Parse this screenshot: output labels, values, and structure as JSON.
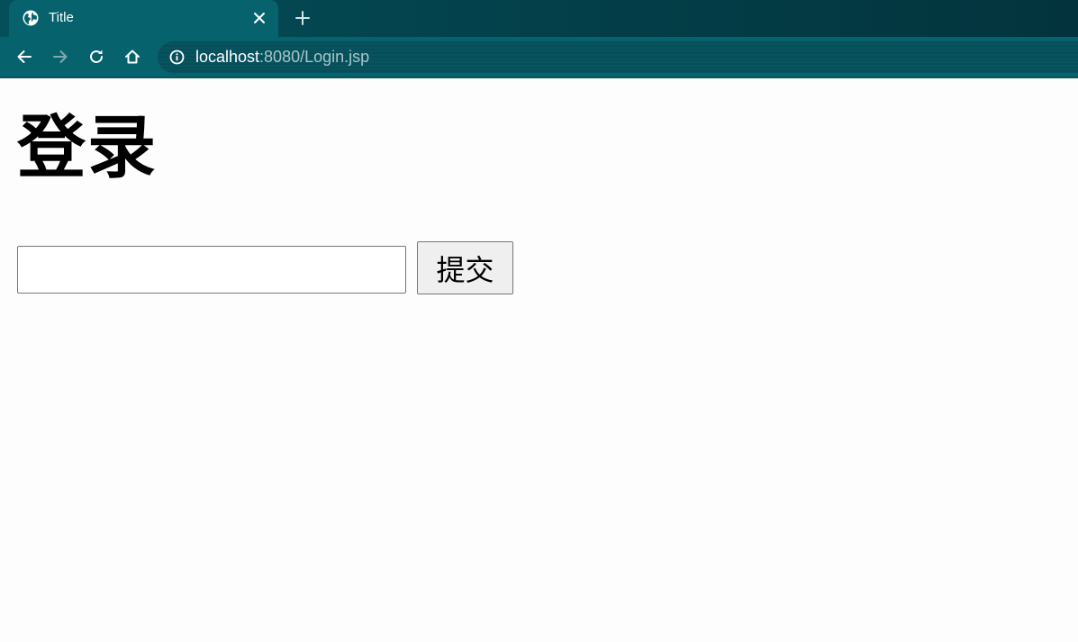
{
  "tab": {
    "title": "Title",
    "favicon": "globe-icon"
  },
  "toolbar": {
    "icons": [
      "back-arrow-icon",
      "forward-arrow-icon",
      "reload-icon",
      "home-icon",
      "info-icon"
    ],
    "url_host": "localhost",
    "url_rest": ":8080/Login.jsp"
  },
  "page": {
    "title": "登录",
    "input_value": "",
    "input_placeholder": "",
    "submit_label": "提交"
  },
  "colors": {
    "tab_bg": "#06626d",
    "toolbar_bg": "#06626d",
    "tabstrip_bg": "#03404a",
    "page_bg": "#fdfdfd",
    "button_bg": "#efefef"
  }
}
